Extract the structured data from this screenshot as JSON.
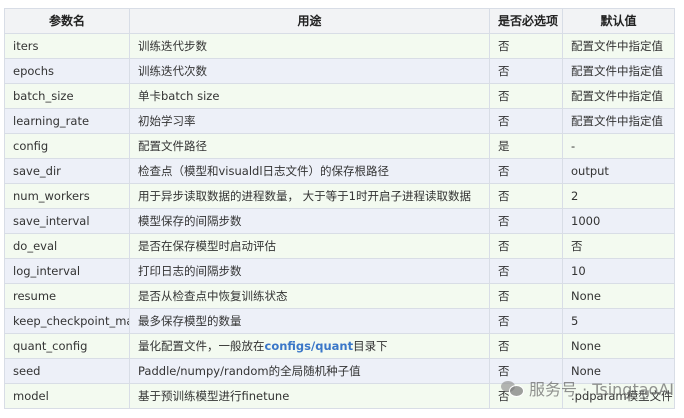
{
  "table": {
    "headers": [
      "参数名",
      "用途",
      "是否必选项",
      "默认值"
    ],
    "rows": [
      {
        "name": "iters",
        "usage": "训练迭代步数",
        "required": "否",
        "default": "配置文件中指定值"
      },
      {
        "name": "epochs",
        "usage": "训练迭代次数",
        "required": "否",
        "default": "配置文件中指定值"
      },
      {
        "name": "batch_size",
        "usage": "单卡batch size",
        "required": "否",
        "default": "配置文件中指定值"
      },
      {
        "name": "learning_rate",
        "usage": "初始学习率",
        "required": "否",
        "default": "配置文件中指定值"
      },
      {
        "name": "config",
        "usage": "配置文件路径",
        "required": "是",
        "default": "-"
      },
      {
        "name": "save_dir",
        "usage": "检查点（模型和visualdl日志文件）的保存根路径",
        "required": "否",
        "default": "output"
      },
      {
        "name": "num_workers",
        "usage": "用于异步读取数据的进程数量， 大于等于1时开启子进程读取数据",
        "required": "否",
        "default": "2"
      },
      {
        "name": "save_interval",
        "usage": "模型保存的间隔步数",
        "required": "否",
        "default": "1000"
      },
      {
        "name": "do_eval",
        "usage": "是否在保存模型时启动评估",
        "required": "否",
        "default": "否"
      },
      {
        "name": "log_interval",
        "usage": "打印日志的间隔步数",
        "required": "否",
        "default": "10"
      },
      {
        "name": "resume",
        "usage": "是否从检查点中恢复训练状态",
        "required": "否",
        "default": "None"
      },
      {
        "name": "keep_checkpoint_max",
        "usage": "最多保存模型的数量",
        "required": "否",
        "default": "5"
      },
      {
        "name": "quant_config",
        "usage_pre": "量化配置文件，一般放在",
        "usage_link": "configs/quant",
        "usage_post": "目录下",
        "required": "否",
        "default": "None"
      },
      {
        "name": "seed",
        "usage": "Paddle/numpy/random的全局随机种子值",
        "required": "否",
        "default": "None"
      },
      {
        "name": "model",
        "usage": "基于预训练模型进行finetune",
        "required": "否",
        "default": ".pdparam模型文件"
      }
    ]
  },
  "watermark": {
    "icon": "wechat-icon",
    "text": "服务号 · TsingtaoAI"
  },
  "colors": {
    "header_bg": "#f2f3f5",
    "row_odd": "#f3faf0",
    "row_even": "#edf0f8",
    "border": "#d8dde6",
    "link": "#3a77c8"
  }
}
